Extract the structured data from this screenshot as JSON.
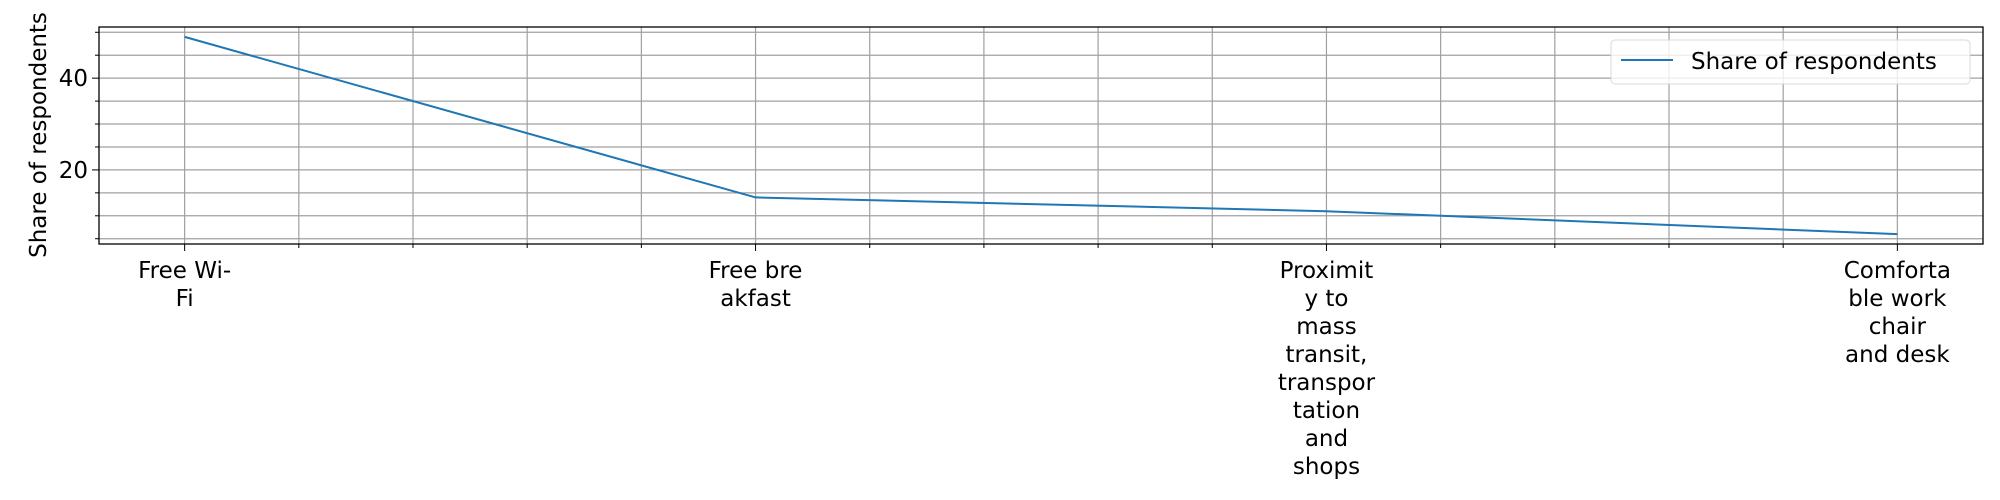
{
  "chart_data": {
    "type": "line",
    "title": "",
    "xlabel": "",
    "ylabel": "Share of respondents",
    "categories": [
      [
        "Free Wi-",
        "Fi"
      ],
      [
        "Free bre",
        "akfast"
      ],
      [
        "Proximit",
        "y to",
        "mass",
        "transit,",
        "transpor",
        "tation",
        "and",
        "shops"
      ],
      [
        "Comforta",
        "ble work",
        "chair",
        "and desk"
      ]
    ],
    "series": [
      {
        "name": "Share of respondents",
        "values": [
          49,
          14,
          11,
          6
        ],
        "color": "#1f77b4"
      }
    ],
    "xlim": [
      -0.15,
      3.15
    ],
    "ylim": [
      3.85,
      51.15
    ],
    "y_major_ticks": [
      20,
      40
    ],
    "y_minor_step": 5,
    "x_minor_step": 0.2,
    "grid": true,
    "grid_color": "#a0a0a0",
    "legend": "top-right"
  }
}
